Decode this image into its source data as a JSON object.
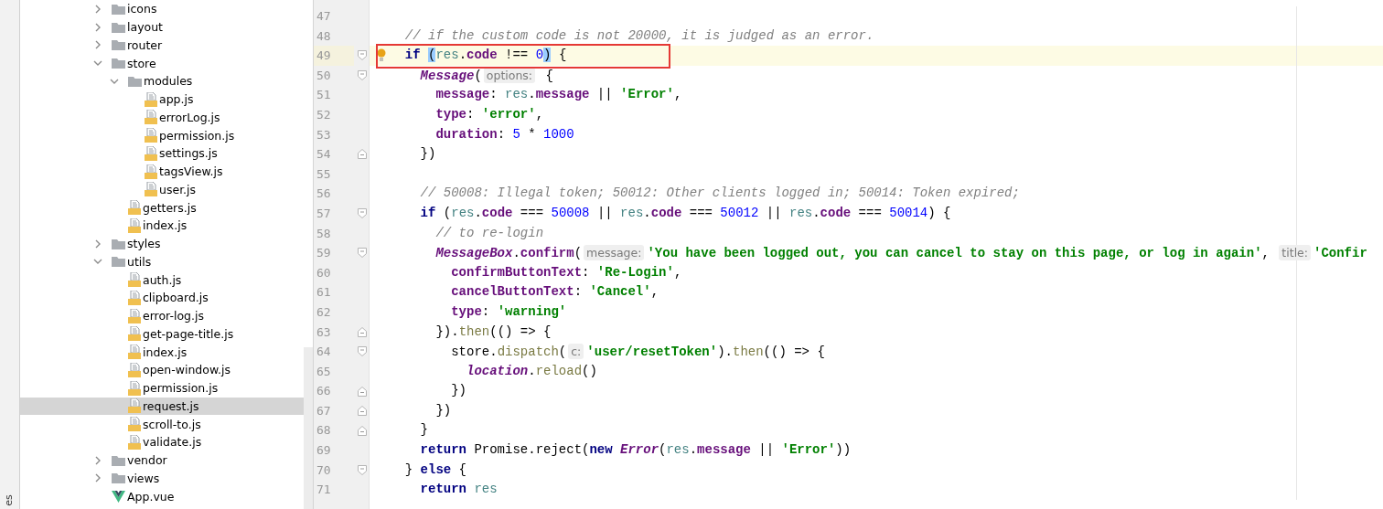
{
  "tool_strip": {
    "tab": "es"
  },
  "project_tree": [
    {
      "kind": "folder",
      "label": "icons",
      "expanded": false,
      "selected": false
    },
    {
      "kind": "folder",
      "label": "layout",
      "expanded": false,
      "selected": false
    },
    {
      "kind": "folder",
      "label": "router",
      "expanded": false,
      "selected": false
    },
    {
      "kind": "folder",
      "label": "store",
      "expanded": true,
      "selected": false,
      "children": [
        {
          "kind": "folder",
          "label": "modules",
          "expanded": true,
          "selected": false,
          "children": [
            {
              "kind": "js",
              "label": "app.js",
              "selected": false
            },
            {
              "kind": "js",
              "label": "errorLog.js",
              "selected": false
            },
            {
              "kind": "js",
              "label": "permission.js",
              "selected": false
            },
            {
              "kind": "js",
              "label": "settings.js",
              "selected": false
            },
            {
              "kind": "js",
              "label": "tagsView.js",
              "selected": false
            },
            {
              "kind": "js",
              "label": "user.js",
              "selected": false
            }
          ]
        },
        {
          "kind": "js",
          "label": "getters.js",
          "selected": false
        },
        {
          "kind": "js",
          "label": "index.js",
          "selected": false
        }
      ]
    },
    {
      "kind": "folder",
      "label": "styles",
      "expanded": false,
      "selected": false
    },
    {
      "kind": "folder",
      "label": "utils",
      "expanded": true,
      "selected": false,
      "children": [
        {
          "kind": "js",
          "label": "auth.js",
          "selected": false
        },
        {
          "kind": "js",
          "label": "clipboard.js",
          "selected": false
        },
        {
          "kind": "js",
          "label": "error-log.js",
          "selected": false
        },
        {
          "kind": "js",
          "label": "get-page-title.js",
          "selected": false
        },
        {
          "kind": "js",
          "label": "index.js",
          "selected": false
        },
        {
          "kind": "js",
          "label": "open-window.js",
          "selected": false
        },
        {
          "kind": "js",
          "label": "permission.js",
          "selected": false
        },
        {
          "kind": "js",
          "label": "request.js",
          "selected": true
        },
        {
          "kind": "js",
          "label": "scroll-to.js",
          "selected": false
        },
        {
          "kind": "js",
          "label": "validate.js",
          "selected": false
        }
      ]
    },
    {
      "kind": "folder",
      "label": "vendor",
      "expanded": false,
      "selected": false
    },
    {
      "kind": "folder",
      "label": "views",
      "expanded": false,
      "selected": false
    },
    {
      "kind": "vue",
      "label": "App.vue",
      "selected": false
    }
  ],
  "editor": {
    "lines": [
      {
        "number": "47",
        "kind": "line",
        "current": false
      },
      {
        "number": "48",
        "kind": "line",
        "current": false,
        "tokens": [
          {
            "kind": "comment",
            "text": "  // if the custom code is not 20000, it is judged as an error."
          }
        ]
      },
      {
        "number": "49",
        "kind": "fold-start",
        "current": true,
        "tokens": [
          {
            "kind": "keyword",
            "text": "  if "
          },
          {
            "kind": "brace-match",
            "text": "("
          },
          {
            "kind": "var",
            "text": "res"
          },
          {
            "kind": "plain",
            "text": "."
          },
          {
            "kind": "prop",
            "text": "code"
          },
          {
            "kind": "plain",
            "text": " !== "
          },
          {
            "kind": "number",
            "text": "0"
          },
          {
            "kind": "brace-match",
            "text": ")"
          },
          {
            "kind": "plain",
            "text": " {"
          }
        ]
      },
      {
        "number": "50",
        "kind": "fold-start",
        "current": false,
        "tokens": [
          {
            "kind": "class",
            "text": "    Message"
          },
          {
            "kind": "plain",
            "text": "("
          },
          {
            "kind": "hint",
            "text": "options:"
          },
          {
            "kind": "plain",
            "text": " {"
          }
        ]
      },
      {
        "number": "51",
        "kind": "line",
        "current": false,
        "tokens": [
          {
            "kind": "prop",
            "text": "      message"
          },
          {
            "kind": "plain",
            "text": ": "
          },
          {
            "kind": "var",
            "text": "res"
          },
          {
            "kind": "plain",
            "text": "."
          },
          {
            "kind": "prop",
            "text": "message"
          },
          {
            "kind": "plain",
            "text": " || "
          },
          {
            "kind": "string",
            "text": "'Error'"
          },
          {
            "kind": "plain",
            "text": ","
          }
        ]
      },
      {
        "number": "52",
        "kind": "line",
        "current": false,
        "tokens": [
          {
            "kind": "prop",
            "text": "      type"
          },
          {
            "kind": "plain",
            "text": ": "
          },
          {
            "kind": "string",
            "text": "'error'"
          },
          {
            "kind": "plain",
            "text": ","
          }
        ]
      },
      {
        "number": "53",
        "kind": "line",
        "current": false,
        "tokens": [
          {
            "kind": "prop",
            "text": "      duration"
          },
          {
            "kind": "plain",
            "text": ": "
          },
          {
            "kind": "number",
            "text": "5"
          },
          {
            "kind": "plain",
            "text": " * "
          },
          {
            "kind": "number",
            "text": "1000"
          }
        ]
      },
      {
        "number": "54",
        "kind": "fold-end",
        "current": false,
        "tokens": [
          {
            "kind": "plain",
            "text": "    })"
          }
        ]
      },
      {
        "number": "55",
        "kind": "line",
        "current": false
      },
      {
        "number": "56",
        "kind": "line",
        "current": false,
        "tokens": [
          {
            "kind": "comment",
            "text": "    // 50008: Illegal token; 50012: Other clients logged in; 50014: Token expired;"
          }
        ]
      },
      {
        "number": "57",
        "kind": "fold-start",
        "current": false,
        "tokens": [
          {
            "kind": "keyword",
            "text": "    if"
          },
          {
            "kind": "plain",
            "text": " ("
          },
          {
            "kind": "var",
            "text": "res"
          },
          {
            "kind": "plain",
            "text": "."
          },
          {
            "kind": "prop",
            "text": "code"
          },
          {
            "kind": "plain",
            "text": " === "
          },
          {
            "kind": "number",
            "text": "50008"
          },
          {
            "kind": "plain",
            "text": " || "
          },
          {
            "kind": "var",
            "text": "res"
          },
          {
            "kind": "plain",
            "text": "."
          },
          {
            "kind": "prop",
            "text": "code"
          },
          {
            "kind": "plain",
            "text": " === "
          },
          {
            "kind": "number",
            "text": "50012"
          },
          {
            "kind": "plain",
            "text": " || "
          },
          {
            "kind": "var",
            "text": "res"
          },
          {
            "kind": "plain",
            "text": "."
          },
          {
            "kind": "prop",
            "text": "code"
          },
          {
            "kind": "plain",
            "text": " === "
          },
          {
            "kind": "number",
            "text": "50014"
          },
          {
            "kind": "plain",
            "text": ") {"
          }
        ]
      },
      {
        "number": "58",
        "kind": "line",
        "current": false,
        "tokens": [
          {
            "kind": "comment",
            "text": "      // to re-login"
          }
        ]
      },
      {
        "number": "59",
        "kind": "fold-start",
        "current": false,
        "tokens": [
          {
            "kind": "class",
            "text": "      MessageBox"
          },
          {
            "kind": "plain",
            "text": "."
          },
          {
            "kind": "prop",
            "text": "confirm"
          },
          {
            "kind": "plain",
            "text": "("
          },
          {
            "kind": "hint",
            "text": "message:"
          },
          {
            "kind": "string",
            "text": "'You have been logged out, you can cancel to stay on this page, or log in again'"
          },
          {
            "kind": "plain",
            "text": ", "
          },
          {
            "kind": "hint",
            "text": "title:"
          },
          {
            "kind": "string",
            "text": "'Confir"
          }
        ]
      },
      {
        "number": "60",
        "kind": "line",
        "current": false,
        "tokens": [
          {
            "kind": "prop",
            "text": "        confirmButtonText"
          },
          {
            "kind": "plain",
            "text": ": "
          },
          {
            "kind": "string",
            "text": "'Re-Login'"
          },
          {
            "kind": "plain",
            "text": ","
          }
        ]
      },
      {
        "number": "61",
        "kind": "line",
        "current": false,
        "tokens": [
          {
            "kind": "prop",
            "text": "        cancelButtonText"
          },
          {
            "kind": "plain",
            "text": ": "
          },
          {
            "kind": "string",
            "text": "'Cancel'"
          },
          {
            "kind": "plain",
            "text": ","
          }
        ]
      },
      {
        "number": "62",
        "kind": "line",
        "current": false,
        "tokens": [
          {
            "kind": "prop",
            "text": "        type"
          },
          {
            "kind": "plain",
            "text": ": "
          },
          {
            "kind": "string",
            "text": "'warning'"
          }
        ]
      },
      {
        "number": "63",
        "kind": "fold-end",
        "current": false,
        "tokens": [
          {
            "kind": "plain",
            "text": "      })."
          },
          {
            "kind": "method",
            "text": "then"
          },
          {
            "kind": "plain",
            "text": "(() => {"
          }
        ]
      },
      {
        "number": "64",
        "kind": "fold-start",
        "current": false,
        "tokens": [
          {
            "kind": "plain",
            "text": "        store."
          },
          {
            "kind": "method",
            "text": "dispatch"
          },
          {
            "kind": "plain",
            "text": "("
          },
          {
            "kind": "hint",
            "text": "c:"
          },
          {
            "kind": "string",
            "text": "'user/resetToken'"
          },
          {
            "kind": "plain",
            "text": ")."
          },
          {
            "kind": "method",
            "text": "then"
          },
          {
            "kind": "plain",
            "text": "(() => {"
          }
        ]
      },
      {
        "number": "65",
        "kind": "line",
        "current": false,
        "tokens": [
          {
            "kind": "class",
            "text": "          location"
          },
          {
            "kind": "plain",
            "text": "."
          },
          {
            "kind": "method",
            "text": "reload"
          },
          {
            "kind": "plain",
            "text": "()"
          }
        ]
      },
      {
        "number": "66",
        "kind": "fold-end",
        "current": false,
        "tokens": [
          {
            "kind": "plain",
            "text": "        })"
          }
        ]
      },
      {
        "number": "67",
        "kind": "fold-end",
        "current": false,
        "tokens": [
          {
            "kind": "plain",
            "text": "      })"
          }
        ]
      },
      {
        "number": "68",
        "kind": "fold-end",
        "current": false,
        "tokens": [
          {
            "kind": "plain",
            "text": "    }"
          }
        ]
      },
      {
        "number": "69",
        "kind": "line",
        "current": false,
        "tokens": [
          {
            "kind": "keyword",
            "text": "    return"
          },
          {
            "kind": "plain",
            "text": " Promise.reject("
          },
          {
            "kind": "keyword",
            "text": "new "
          },
          {
            "kind": "class",
            "text": "Error"
          },
          {
            "kind": "plain",
            "text": "("
          },
          {
            "kind": "var",
            "text": "res"
          },
          {
            "kind": "plain",
            "text": "."
          },
          {
            "kind": "prop",
            "text": "message"
          },
          {
            "kind": "plain",
            "text": " || "
          },
          {
            "kind": "string",
            "text": "'Error'"
          },
          {
            "kind": "plain",
            "text": "))"
          }
        ]
      },
      {
        "number": "70",
        "kind": "fold-start",
        "current": false,
        "tokens": [
          {
            "kind": "plain",
            "text": "  } "
          },
          {
            "kind": "keyword",
            "text": "else"
          },
          {
            "kind": "plain",
            "text": " {"
          }
        ]
      },
      {
        "number": "71",
        "kind": "line",
        "current": false,
        "tokens": [
          {
            "kind": "keyword",
            "text": "    return "
          },
          {
            "kind": "var",
            "text": "res"
          }
        ]
      }
    ]
  }
}
